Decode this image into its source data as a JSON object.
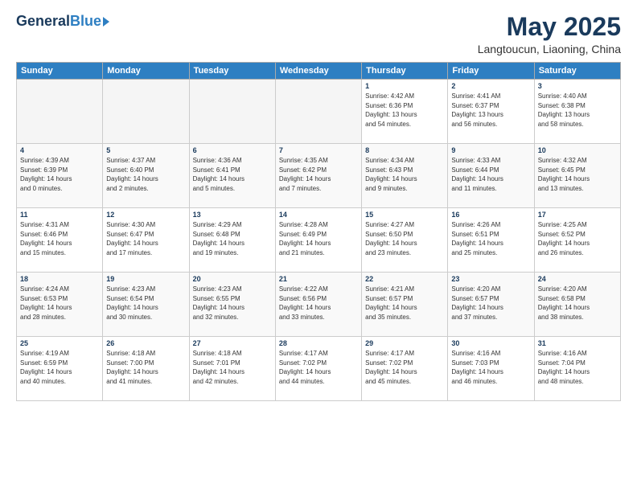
{
  "logo": {
    "general": "General",
    "blue": "Blue"
  },
  "header": {
    "title": "May 2025",
    "subtitle": "Langtoucun, Liaoning, China"
  },
  "days_of_week": [
    "Sunday",
    "Monday",
    "Tuesday",
    "Wednesday",
    "Thursday",
    "Friday",
    "Saturday"
  ],
  "weeks": [
    [
      {
        "day": "",
        "info": ""
      },
      {
        "day": "",
        "info": ""
      },
      {
        "day": "",
        "info": ""
      },
      {
        "day": "",
        "info": ""
      },
      {
        "day": "1",
        "info": "Sunrise: 4:42 AM\nSunset: 6:36 PM\nDaylight: 13 hours\nand 54 minutes."
      },
      {
        "day": "2",
        "info": "Sunrise: 4:41 AM\nSunset: 6:37 PM\nDaylight: 13 hours\nand 56 minutes."
      },
      {
        "day": "3",
        "info": "Sunrise: 4:40 AM\nSunset: 6:38 PM\nDaylight: 13 hours\nand 58 minutes."
      }
    ],
    [
      {
        "day": "4",
        "info": "Sunrise: 4:39 AM\nSunset: 6:39 PM\nDaylight: 14 hours\nand 0 minutes."
      },
      {
        "day": "5",
        "info": "Sunrise: 4:37 AM\nSunset: 6:40 PM\nDaylight: 14 hours\nand 2 minutes."
      },
      {
        "day": "6",
        "info": "Sunrise: 4:36 AM\nSunset: 6:41 PM\nDaylight: 14 hours\nand 5 minutes."
      },
      {
        "day": "7",
        "info": "Sunrise: 4:35 AM\nSunset: 6:42 PM\nDaylight: 14 hours\nand 7 minutes."
      },
      {
        "day": "8",
        "info": "Sunrise: 4:34 AM\nSunset: 6:43 PM\nDaylight: 14 hours\nand 9 minutes."
      },
      {
        "day": "9",
        "info": "Sunrise: 4:33 AM\nSunset: 6:44 PM\nDaylight: 14 hours\nand 11 minutes."
      },
      {
        "day": "10",
        "info": "Sunrise: 4:32 AM\nSunset: 6:45 PM\nDaylight: 14 hours\nand 13 minutes."
      }
    ],
    [
      {
        "day": "11",
        "info": "Sunrise: 4:31 AM\nSunset: 6:46 PM\nDaylight: 14 hours\nand 15 minutes."
      },
      {
        "day": "12",
        "info": "Sunrise: 4:30 AM\nSunset: 6:47 PM\nDaylight: 14 hours\nand 17 minutes."
      },
      {
        "day": "13",
        "info": "Sunrise: 4:29 AM\nSunset: 6:48 PM\nDaylight: 14 hours\nand 19 minutes."
      },
      {
        "day": "14",
        "info": "Sunrise: 4:28 AM\nSunset: 6:49 PM\nDaylight: 14 hours\nand 21 minutes."
      },
      {
        "day": "15",
        "info": "Sunrise: 4:27 AM\nSunset: 6:50 PM\nDaylight: 14 hours\nand 23 minutes."
      },
      {
        "day": "16",
        "info": "Sunrise: 4:26 AM\nSunset: 6:51 PM\nDaylight: 14 hours\nand 25 minutes."
      },
      {
        "day": "17",
        "info": "Sunrise: 4:25 AM\nSunset: 6:52 PM\nDaylight: 14 hours\nand 26 minutes."
      }
    ],
    [
      {
        "day": "18",
        "info": "Sunrise: 4:24 AM\nSunset: 6:53 PM\nDaylight: 14 hours\nand 28 minutes."
      },
      {
        "day": "19",
        "info": "Sunrise: 4:23 AM\nSunset: 6:54 PM\nDaylight: 14 hours\nand 30 minutes."
      },
      {
        "day": "20",
        "info": "Sunrise: 4:23 AM\nSunset: 6:55 PM\nDaylight: 14 hours\nand 32 minutes."
      },
      {
        "day": "21",
        "info": "Sunrise: 4:22 AM\nSunset: 6:56 PM\nDaylight: 14 hours\nand 33 minutes."
      },
      {
        "day": "22",
        "info": "Sunrise: 4:21 AM\nSunset: 6:57 PM\nDaylight: 14 hours\nand 35 minutes."
      },
      {
        "day": "23",
        "info": "Sunrise: 4:20 AM\nSunset: 6:57 PM\nDaylight: 14 hours\nand 37 minutes."
      },
      {
        "day": "24",
        "info": "Sunrise: 4:20 AM\nSunset: 6:58 PM\nDaylight: 14 hours\nand 38 minutes."
      }
    ],
    [
      {
        "day": "25",
        "info": "Sunrise: 4:19 AM\nSunset: 6:59 PM\nDaylight: 14 hours\nand 40 minutes."
      },
      {
        "day": "26",
        "info": "Sunrise: 4:18 AM\nSunset: 7:00 PM\nDaylight: 14 hours\nand 41 minutes."
      },
      {
        "day": "27",
        "info": "Sunrise: 4:18 AM\nSunset: 7:01 PM\nDaylight: 14 hours\nand 42 minutes."
      },
      {
        "day": "28",
        "info": "Sunrise: 4:17 AM\nSunset: 7:02 PM\nDaylight: 14 hours\nand 44 minutes."
      },
      {
        "day": "29",
        "info": "Sunrise: 4:17 AM\nSunset: 7:02 PM\nDaylight: 14 hours\nand 45 minutes."
      },
      {
        "day": "30",
        "info": "Sunrise: 4:16 AM\nSunset: 7:03 PM\nDaylight: 14 hours\nand 46 minutes."
      },
      {
        "day": "31",
        "info": "Sunrise: 4:16 AM\nSunset: 7:04 PM\nDaylight: 14 hours\nand 48 minutes."
      }
    ]
  ]
}
